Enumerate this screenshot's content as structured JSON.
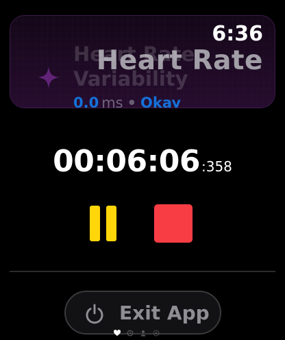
{
  "background_card": {
    "title": "Heart Rate\nVariability",
    "value": "0.0",
    "unit": "ms",
    "separator": "•",
    "status": "Okay"
  },
  "status_bar": {
    "time": "6:36"
  },
  "app_title": "Heart Rate",
  "timer": {
    "main": "00:06:06",
    "ms": ":358"
  },
  "controls": {
    "pause_icon": "pause-icon",
    "stop_icon": "stop-icon"
  },
  "exit_button": {
    "label": "Exit App",
    "icon": "power-icon"
  },
  "page_indicator": {
    "items": [
      "heart-icon",
      "clock-icon",
      "person-icon",
      "gear-icon"
    ],
    "active_index": 0
  },
  "colors": {
    "pause": "#ffd60a",
    "stop": "#f93d45",
    "accent_blue": "#1472d8",
    "background": "#000000"
  }
}
